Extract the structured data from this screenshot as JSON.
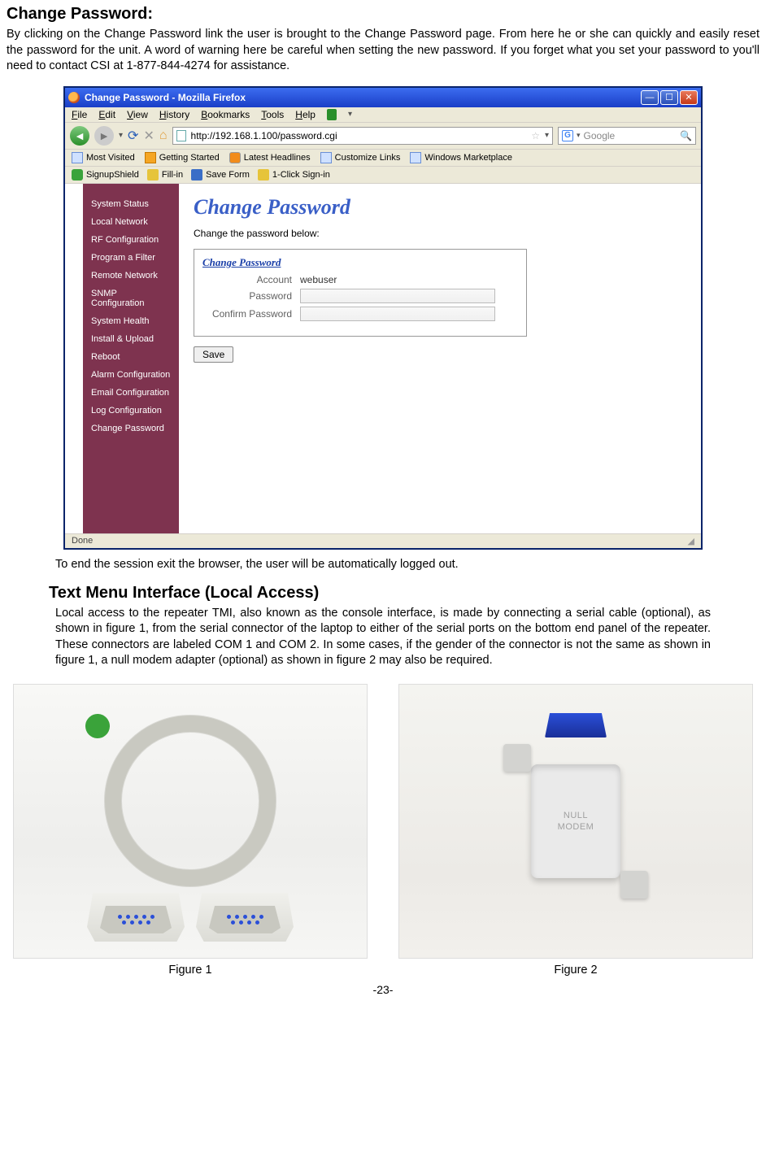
{
  "section1": {
    "heading": "Change Password:",
    "body": "By clicking on the Change Password link the user is brought to the Change Password page.  From here he or she can quickly and easily reset the password for the unit.  A word of warning here be careful when setting the new password. If you forget what you set your password to you'll need to contact CSI at 1-877-844-4274 for assistance."
  },
  "browser": {
    "title": "Change Password - Mozilla Firefox",
    "menu": {
      "file": "File",
      "edit": "Edit",
      "view": "View",
      "history": "History",
      "bookmarks": "Bookmarks",
      "tools": "Tools",
      "help": "Help"
    },
    "url": "http://192.168.1.100/password.cgi",
    "search_placeholder": "Google",
    "bookmarks": {
      "most_visited": "Most Visited",
      "getting_started": "Getting Started",
      "latest_headlines": "Latest Headlines",
      "customize_links": "Customize Links",
      "windows_marketplace": "Windows Marketplace"
    },
    "toolbar2": {
      "signup": "SignupShield",
      "fillin": "Fill-in",
      "saveform": "Save Form",
      "oneclick": "1-Click Sign-in"
    },
    "sidebar": [
      "System Status",
      "Local Network",
      "RF Configuration",
      "Program a Filter",
      "Remote Network",
      "SNMP Configuration",
      "System Health",
      "Install & Upload",
      "Reboot",
      "Alarm Configuration",
      "Email Configuration",
      "Log Configuration",
      "Change Password"
    ],
    "page": {
      "heading": "Change Password",
      "instruction": "Change the password below:",
      "form_title": "Change Password",
      "account_label": "Account",
      "account_value": "webuser",
      "password_label": "Password",
      "confirm_label": "Confirm Password",
      "save": "Save"
    },
    "status": "Done"
  },
  "caption1": "To end the session exit  the browser, the user will be automatically logged out.",
  "section2": {
    "heading": "Text Menu Interface (Local Access)",
    "body": "Local access to  the repeater TMI, also known as the console interface, is made by connecting a serial cable (optional), as shown in figure 1, from  the serial connector of the laptop to either of the serial ports on the bottom end panel of the repeater. These connectors are labeled COM 1 and COM 2. In some cases, if the gender of the connector is not the same as shown in figure 1, a null modem adapter (optional) as shown in figure 2 may also be required."
  },
  "adapter_text": "NULL\nMODEM",
  "fig1": "Figure 1",
  "fig2": "Figure 2",
  "pagenum": "-23-"
}
